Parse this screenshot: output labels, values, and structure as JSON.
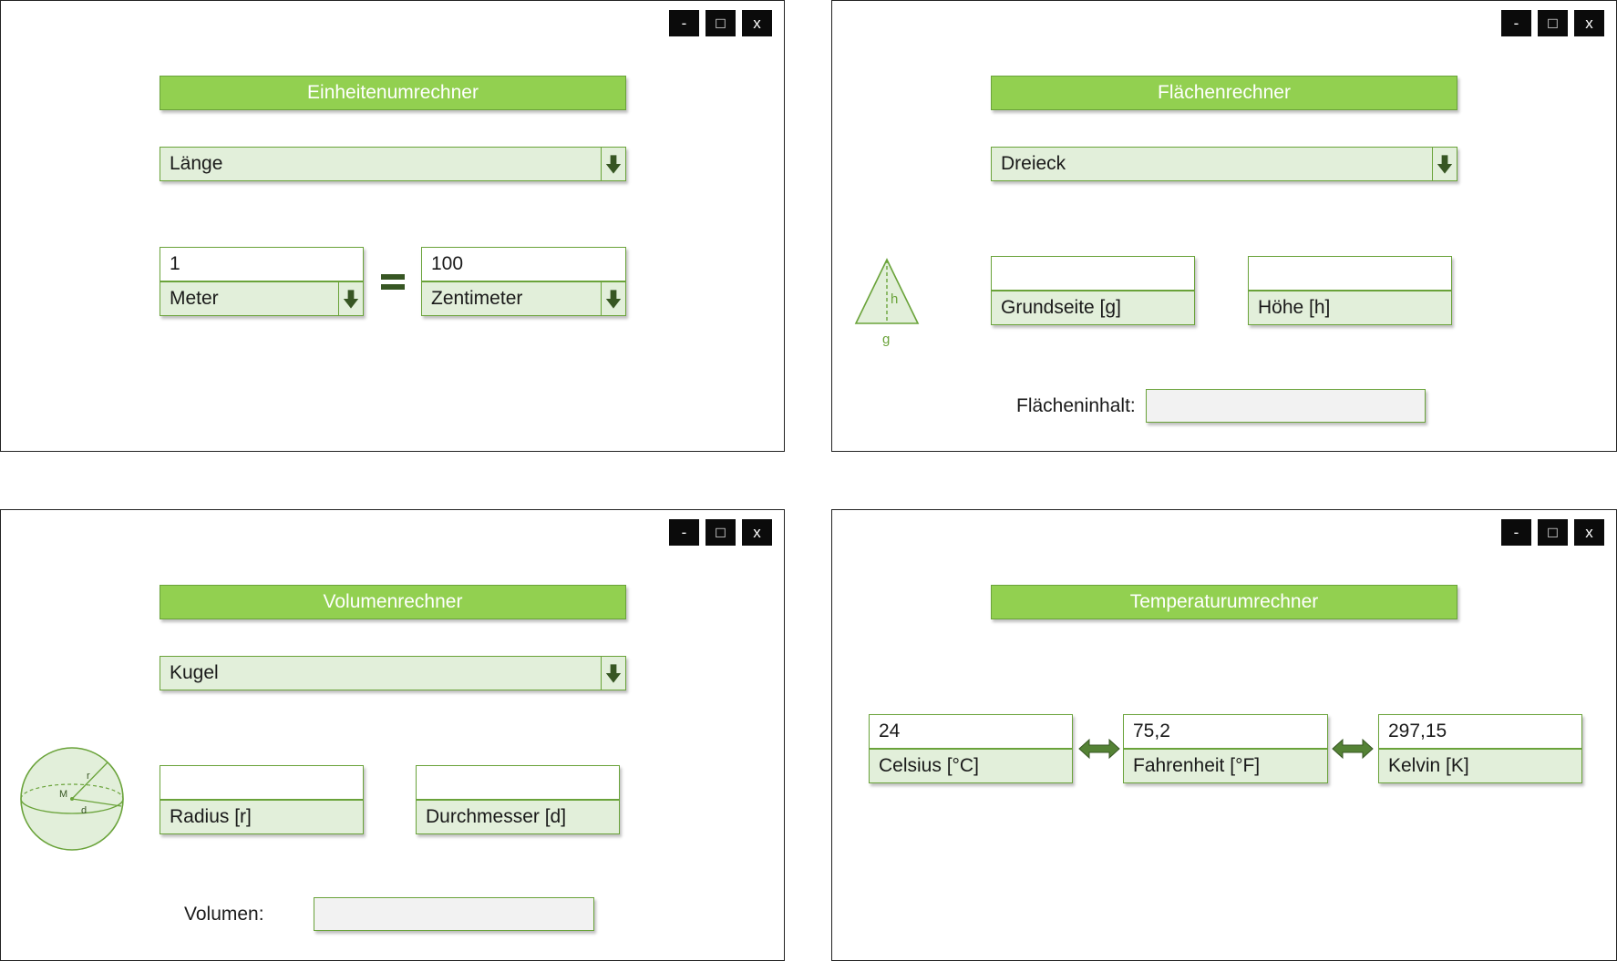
{
  "window_controls": {
    "minimize": "-",
    "maximize": "□",
    "close": "x"
  },
  "panels": {
    "units": {
      "title": "Einheitenumrechner",
      "category": "Länge",
      "from_value": "1",
      "from_unit": "Meter",
      "equals_icon": "equals-icon",
      "to_value": "100",
      "to_unit": "Zentimeter"
    },
    "area": {
      "title": "Flächenrechner",
      "shape": "Dreieck",
      "diagram_labels": {
        "height": "h",
        "base": "g"
      },
      "base_value": "",
      "base_label": "Grundseite [g]",
      "height_value": "",
      "height_label": "Höhe [h]",
      "result_label": "Flächeninhalt:",
      "result_value": ""
    },
    "volume": {
      "title": "Volumenrechner",
      "shape": "Kugel",
      "diagram_labels": {
        "center": "M",
        "radius": "r",
        "diameter": "d"
      },
      "radius_value": "",
      "radius_label": "Radius [r]",
      "diameter_value": "",
      "diameter_label": "Durchmesser [d]",
      "result_label": "Volumen:",
      "result_value": ""
    },
    "temperature": {
      "title": "Temperaturumrechner",
      "celsius_value": "24",
      "celsius_label": "Celsius [°C]",
      "fahrenheit_value": "75,2",
      "fahrenheit_label": "Fahrenheit [°F]",
      "kelvin_value": "297,15",
      "kelvin_label": "Kelvin [K]"
    }
  },
  "colors": {
    "accent": "#92d050",
    "field_bg": "#e2efda",
    "border": "#6aa33a",
    "arrow": "#375623",
    "result_bg": "#f2f2f2"
  }
}
